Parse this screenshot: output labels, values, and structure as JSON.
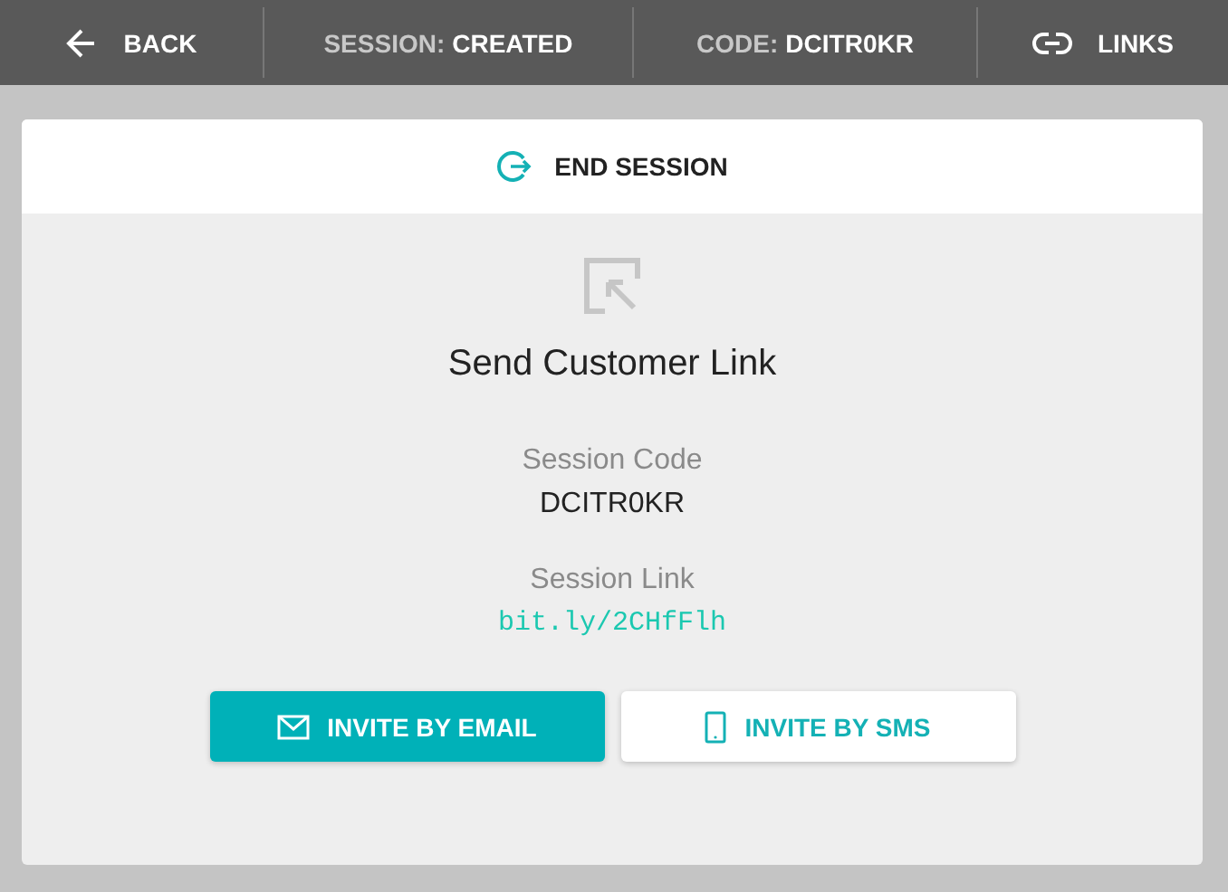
{
  "top_bar": {
    "back": {
      "label": "BACK"
    },
    "status": [
      {
        "label": "SESSION:",
        "value": "CREATED"
      },
      {
        "label": "CODE:",
        "value": "DCITR0KR"
      }
    ],
    "links": {
      "label": "LINKS"
    }
  },
  "card": {
    "end_session": {
      "label": "END SESSION"
    },
    "title": "Send Customer Link",
    "fields": [
      {
        "label": "Session Code",
        "value": "DCITR0KR",
        "kind": "code"
      },
      {
        "label": "Session Link",
        "value": "bit.ly/2CHfFlh",
        "kind": "link"
      }
    ],
    "buttons": [
      {
        "label": "INVITE BY EMAIL",
        "kind": "email",
        "primary": true
      },
      {
        "label": "INVITE BY SMS",
        "kind": "sms",
        "primary": false
      }
    ]
  }
}
